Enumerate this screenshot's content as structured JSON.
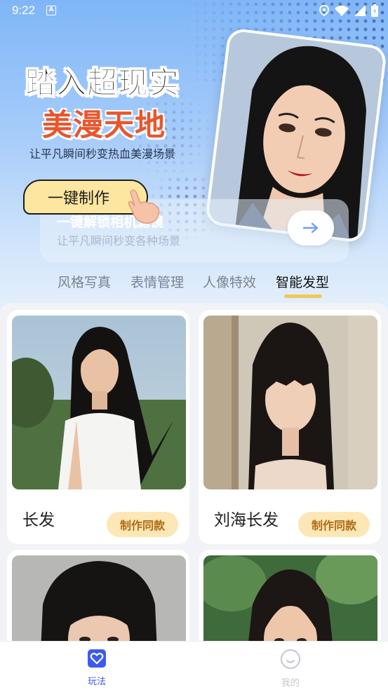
{
  "status_bar": {
    "time": "9:22",
    "a_badge": "A"
  },
  "hero": {
    "title_line1": "踏入超现实",
    "title_line2": "美漫天地",
    "subtitle": "让平凡瞬间秒变热血美漫场景",
    "make_button": "一键制作",
    "banner_title": "一键解锁相机滤镜",
    "banner_subtitle": "让平凡瞬间秒变各种场景"
  },
  "tabs": [
    {
      "label": "风格写真",
      "active": false
    },
    {
      "label": "表情管理",
      "active": false
    },
    {
      "label": "人像特效",
      "active": false
    },
    {
      "label": "智能发型",
      "active": true
    }
  ],
  "cards": [
    {
      "title": "长发",
      "button": "制作同款"
    },
    {
      "title": "刘海长发",
      "button": "制作同款"
    },
    {
      "title": "",
      "button": ""
    },
    {
      "title": "",
      "button": ""
    }
  ],
  "bottom_nav": [
    {
      "label": "玩法",
      "icon": "heart-icon",
      "active": true
    },
    {
      "label": "我的",
      "icon": "smile-icon",
      "active": false
    }
  ],
  "colors": {
    "accent": "#3b5bf0",
    "tab_underline": "#f4c55a",
    "button_bg": "#fde7b6",
    "button_text": "#b06b17",
    "title_orange": "#e8562d"
  }
}
